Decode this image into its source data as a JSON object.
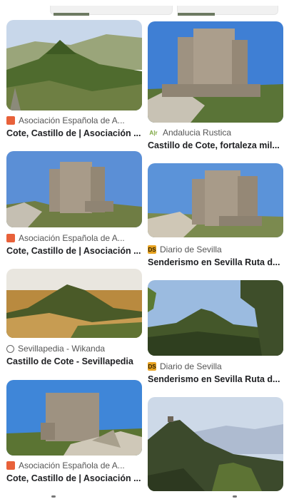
{
  "results": {
    "left": [
      {
        "source": "Asociación Española de A...",
        "title": "Cote, Castillo de | Asociación ...",
        "favicon": "asociacion-icon",
        "image_desc": "hill"
      },
      {
        "source": "Asociación Española de A...",
        "title": "Cote, Castillo de | Asociación ...",
        "favicon": "asociacion-icon",
        "image_desc": "tower"
      },
      {
        "source": "Sevillapedia - Wikanda",
        "title": "Castillo de Cote - Sevillapedia",
        "favicon": "globe-icon",
        "image_desc": "landscape"
      },
      {
        "source": "Asociación Española de A...",
        "title": "Cote, Castillo de | Asociación ...",
        "favicon": "asociacion-icon",
        "image_desc": "tower-near"
      }
    ],
    "right": [
      {
        "source": "Andalucia Rustica",
        "title": "Castillo de Cote, fortaleza mil...",
        "favicon": "andalucia-icon",
        "favicon_text": "A|r",
        "image_desc": "tower"
      },
      {
        "source": "Diario de Sevilla",
        "title": "Senderismo en Sevilla Ruta d...",
        "favicon": "ds-icon",
        "favicon_text": "DS",
        "image_desc": "tower"
      },
      {
        "source": "Diario de Sevilla",
        "title": "Senderismo en Sevilla Ruta d...",
        "favicon": "ds-icon",
        "favicon_text": "DS",
        "image_desc": "hill-trees"
      },
      {
        "source": "",
        "title": "",
        "favicon": "",
        "image_desc": "mountain"
      }
    ]
  },
  "colors": {
    "sky": "#5b8fd6",
    "stone": "#a79a88",
    "grass": "#4f6b2e",
    "title": "#202124",
    "source": "#555555"
  }
}
